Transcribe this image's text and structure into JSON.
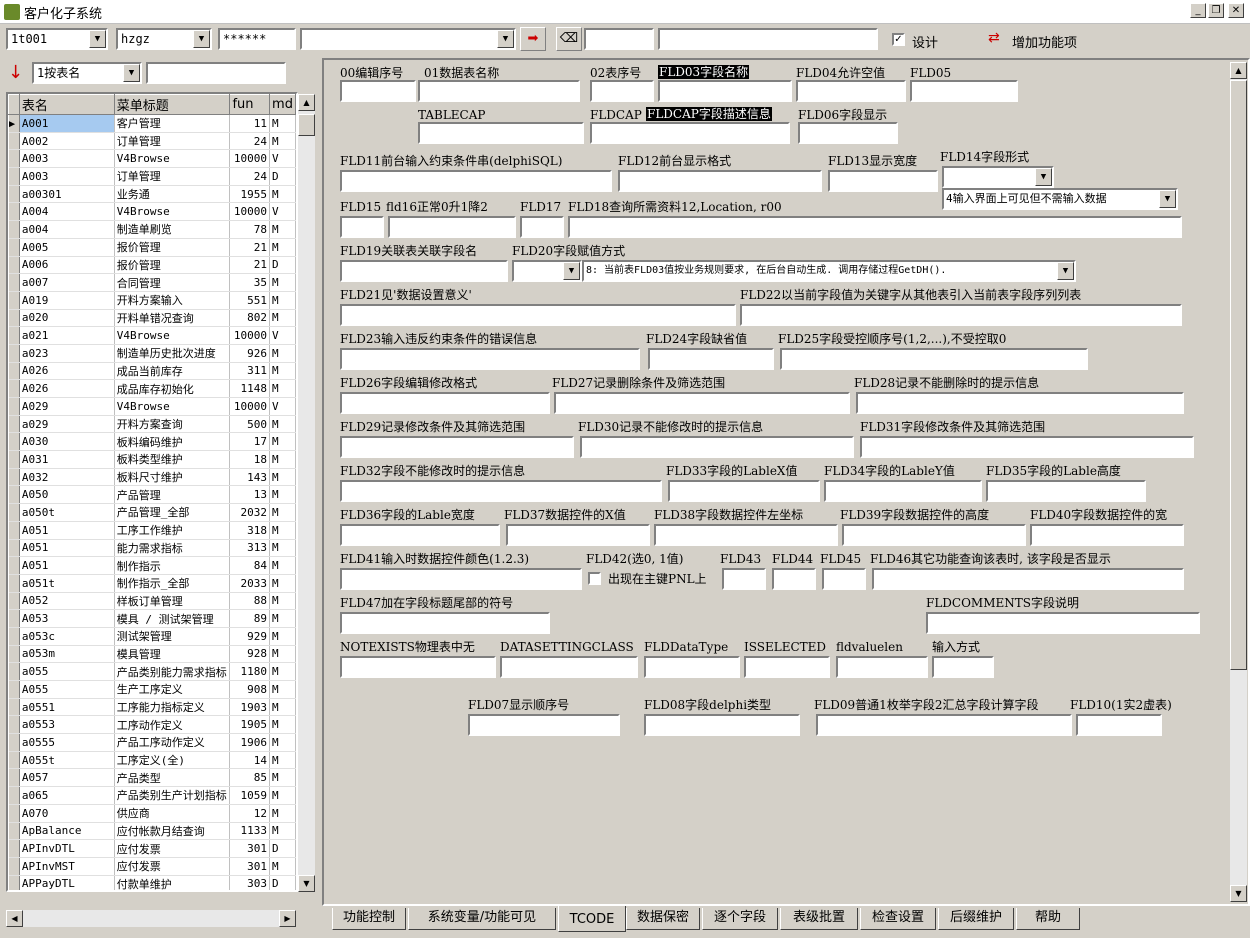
{
  "window": {
    "title": "客户化子系统"
  },
  "toolbar": {
    "table_combo": "1t001",
    "user_combo": "hzgz",
    "password": "******",
    "main_combo": "",
    "search_input": "",
    "search_input2": "",
    "design_checkbox_label": "设计",
    "design_checked": true,
    "add_feature_label": "增加功能项"
  },
  "left": {
    "sort_combo": "1按表名",
    "filter_input": "",
    "columns": [
      "表名",
      "菜单标题",
      "fun",
      "md"
    ],
    "rows": [
      [
        "A001",
        "客户管理",
        "11",
        "M"
      ],
      [
        "A002",
        "订单管理",
        "24",
        "M"
      ],
      [
        "A003",
        "V4Browse",
        "10000",
        "V"
      ],
      [
        "A003",
        "订单管理",
        "24",
        "D"
      ],
      [
        "a00301",
        "业务通",
        "1955",
        "M"
      ],
      [
        "A004",
        "V4Browse",
        "10000",
        "V"
      ],
      [
        "a004",
        "制造单刷览",
        "78",
        "M"
      ],
      [
        "A005",
        "报价管理",
        "21",
        "M"
      ],
      [
        "A006",
        "报价管理",
        "21",
        "D"
      ],
      [
        "a007",
        "合同管理",
        "35",
        "M"
      ],
      [
        "A019",
        "开料方案输入",
        "551",
        "M"
      ],
      [
        "a020",
        "开料单错况查询",
        "802",
        "M"
      ],
      [
        "a021",
        "V4Browse",
        "10000",
        "V"
      ],
      [
        "a023",
        "制造单历史批次进度",
        "926",
        "M"
      ],
      [
        "A026",
        "成品当前库存",
        "311",
        "M"
      ],
      [
        "A026",
        "成品库存初始化",
        "1148",
        "M"
      ],
      [
        "A029",
        "V4Browse",
        "10000",
        "V"
      ],
      [
        "a029",
        "开料方案查询",
        "500",
        "M"
      ],
      [
        "A030",
        "板料编码维护",
        "17",
        "M"
      ],
      [
        "A031",
        "板料类型维护",
        "18",
        "M"
      ],
      [
        "A032",
        "板料尺寸维护",
        "143",
        "M"
      ],
      [
        "A050",
        "产品管理",
        "13",
        "M"
      ],
      [
        "a050t",
        "产品管理_全部",
        "2032",
        "M"
      ],
      [
        "A051",
        "工序工作维护",
        "318",
        "M"
      ],
      [
        "A051",
        "能力需求指标",
        "313",
        "M"
      ],
      [
        "A051",
        "制作指示",
        "84",
        "M"
      ],
      [
        "a051t",
        "制作指示_全部",
        "2033",
        "M"
      ],
      [
        "A052",
        "样板订单管理",
        "88",
        "M"
      ],
      [
        "A053",
        "模具 / 测试架管理",
        "89",
        "M"
      ],
      [
        "a053c",
        "测试架管理",
        "929",
        "M"
      ],
      [
        "a053m",
        "模具管理",
        "928",
        "M"
      ],
      [
        "a055",
        "产品类别能力需求指标",
        "1180",
        "M"
      ],
      [
        "A055",
        "生产工序定义",
        "908",
        "M"
      ],
      [
        "a0551",
        "工序能力指标定义",
        "1903",
        "M"
      ],
      [
        "a0553",
        "工序动作定义",
        "1905",
        "M"
      ],
      [
        "a0555",
        "产品工序动作定义",
        "1906",
        "M"
      ],
      [
        "A055t",
        "工序定义(全)",
        "14",
        "M"
      ],
      [
        "A057",
        "产品类型",
        "85",
        "M"
      ],
      [
        "a065",
        "产品类别生产计划指标",
        "1059",
        "M"
      ],
      [
        "A070",
        "供应商",
        "12",
        "M"
      ],
      [
        "ApBalance",
        "应付帐款月结查询",
        "1133",
        "M"
      ],
      [
        "APInvDTL",
        "应付发票",
        "301",
        "D"
      ],
      [
        "APInvMST",
        "应付发票",
        "301",
        "M"
      ],
      [
        "APPayDTL",
        "付款单维护",
        "303",
        "D"
      ]
    ]
  },
  "form": {
    "f00": "00编辑序号",
    "f01": "01数据表名称",
    "f02": "02表序号",
    "f03": "FLD03字段名称",
    "f04": "FLD04允许空值",
    "f05": "FLD05",
    "tablecap": "TABLECAP",
    "fldcap": "FLDCAP",
    "fldcap_desc": "FLDCAP字段描述信息",
    "f06": "FLD06字段显示",
    "f11": "FLD11前台输入约束条件串(delphiSQL)",
    "f12": "FLD12前台显示格式",
    "f13": "FLD13显示宽度",
    "f14": "FLD14字段形式",
    "f14_combo2": "4输入界面上可见但不需输入数据",
    "f15": "FLD15",
    "f16": "fld16正常0升1降2",
    "f17": "FLD17",
    "f18": "FLD18查询所需资料12,Location, r00",
    "f19": "FLD19关联表关联字段名",
    "f20": "FLD20字段赋值方式",
    "f20_combo2": "8: 当前表FLD03值按业务规则要求, 在后台自动生成. 调用存储过程GetDH().",
    "f21": "FLD21见'数据设置意义'",
    "f22": "FLD22以当前字段值为关键字从其他表引入当前表字段序列列表",
    "f23": "FLD23输入违反约束条件的错误信息",
    "f24": "FLD24字段缺省值",
    "f25": "FLD25字段受控顺序号(1,2,...),不受控取0",
    "f26": "FLD26字段编辑修改格式",
    "f27": "FLD27记录删除条件及筛选范围",
    "f28": "FLD28记录不能删除时的提示信息",
    "f29": "FLD29记录修改条件及其筛选范围",
    "f30": "FLD30记录不能修改时的提示信息",
    "f31": "FLD31字段修改条件及其筛选范围",
    "f32": "FLD32字段不能修改时的提示信息",
    "f33": "FLD33字段的LableX值",
    "f34": "FLD34字段的LableY值",
    "f35": "FLD35字段的Lable高度",
    "f36": "FLD36字段的Lable宽度",
    "f37": "FLD37数据控件的X值",
    "f38": "FLD38字段数据控件左坐标",
    "f39": "FLD39字段数据控件的高度",
    "f40": "FLD40字段数据控件的宽",
    "f41": "FLD41输入时数据控件颜色(1.2.3)",
    "f42": "FLD42(选0, 1值)",
    "f42_chk": "出现在主键PNL上",
    "f43": "FLD43",
    "f44": "FLD44",
    "f45": "FLD45",
    "f46": "FLD46其它功能查询该表时, 该字段是否显示",
    "f47": "FLD47加在字段标题尾部的符号",
    "fldcomments": "FLDCOMMENTS字段说明",
    "notexists": "NOTEXISTS物理表中无",
    "datasettingclass": "DATASETTINGCLASS",
    "flddatatype": "FLDDataType",
    "isselected": "ISSELECTED",
    "fldvaluelen": "fldvaluelen",
    "inputmode": "输入方式",
    "f07": "FLD07显示顺序号",
    "f08": "FLD08字段delphi类型",
    "f09": "FLD09普通1枚举字段2汇总字段计算字段",
    "f10": "FLD10(1实2虚表)"
  },
  "tabs": [
    "功能控制",
    "系统变量/功能可见",
    "TCODE",
    "数据保密",
    "逐个字段",
    "表级批置",
    "检查设置",
    "后缀维护",
    "帮助"
  ],
  "active_tab": "TCODE"
}
